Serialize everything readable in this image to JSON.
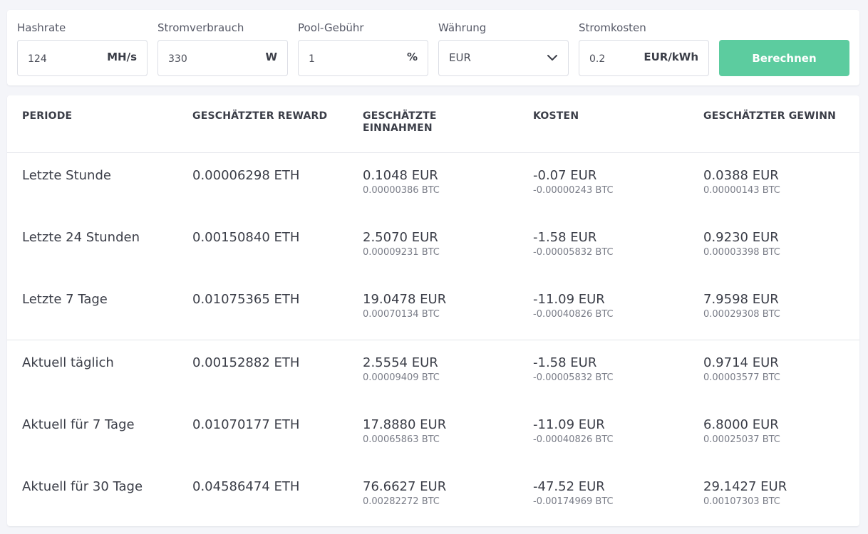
{
  "form": {
    "hashrate": {
      "label": "Hashrate",
      "value": "124",
      "unit": "MH/s"
    },
    "power": {
      "label": "Stromverbrauch",
      "value": "330",
      "unit": "W"
    },
    "pool_fee": {
      "label": "Pool-Gebühr",
      "value": "1",
      "unit": "%"
    },
    "currency": {
      "label": "Währung",
      "selected": "EUR"
    },
    "electricity_cost": {
      "label": "Stromkosten",
      "value": "0.2",
      "unit": "EUR/kWh"
    },
    "calculate_label": "Berechnen",
    "button_color": "#5ccc9f"
  },
  "table": {
    "headers": [
      "PERIODE",
      "GESCHÄTZTER REWARD",
      "GESCHÄTZTE EINNAHMEN",
      "KOSTEN",
      "GESCHÄTZTER GEWINN"
    ],
    "rows": [
      {
        "period": "Letzte Stunde",
        "reward": "0.00006298 ETH",
        "revenue": {
          "fiat": "0.1048 EUR",
          "btc": "0.00000386 BTC"
        },
        "cost": {
          "fiat": "-0.07 EUR",
          "btc": "-0.00000243 BTC"
        },
        "profit": {
          "fiat": "0.0388 EUR",
          "btc": "0.00000143 BTC"
        }
      },
      {
        "period": "Letzte 24 Stunden",
        "reward": "0.00150840 ETH",
        "revenue": {
          "fiat": "2.5070 EUR",
          "btc": "0.00009231 BTC"
        },
        "cost": {
          "fiat": "-1.58 EUR",
          "btc": "-0.00005832 BTC"
        },
        "profit": {
          "fiat": "0.9230 EUR",
          "btc": "0.00003398 BTC"
        }
      },
      {
        "period": "Letzte 7 Tage",
        "reward": "0.01075365 ETH",
        "revenue": {
          "fiat": "19.0478 EUR",
          "btc": "0.00070134 BTC"
        },
        "cost": {
          "fiat": "-11.09 EUR",
          "btc": "-0.00040826 BTC"
        },
        "profit": {
          "fiat": "7.9598 EUR",
          "btc": "0.00029308 BTC"
        }
      },
      {
        "period": "Aktuell täglich",
        "reward": "0.00152882 ETH",
        "revenue": {
          "fiat": "2.5554 EUR",
          "btc": "0.00009409 BTC"
        },
        "cost": {
          "fiat": "-1.58 EUR",
          "btc": "-0.00005832 BTC"
        },
        "profit": {
          "fiat": "0.9714 EUR",
          "btc": "0.00003577 BTC"
        }
      },
      {
        "period": "Aktuell für 7 Tage",
        "reward": "0.01070177 ETH",
        "revenue": {
          "fiat": "17.8880 EUR",
          "btc": "0.00065863 BTC"
        },
        "cost": {
          "fiat": "-11.09 EUR",
          "btc": "-0.00040826 BTC"
        },
        "profit": {
          "fiat": "6.8000 EUR",
          "btc": "0.00025037 BTC"
        }
      },
      {
        "period": "Aktuell für 30 Tage",
        "reward": "0.04586474 ETH",
        "revenue": {
          "fiat": "76.6627 EUR",
          "btc": "0.00282272 BTC"
        },
        "cost": {
          "fiat": "-47.52 EUR",
          "btc": "-0.00174969 BTC"
        },
        "profit": {
          "fiat": "29.1427 EUR",
          "btc": "0.00107303 BTC"
        }
      }
    ]
  }
}
